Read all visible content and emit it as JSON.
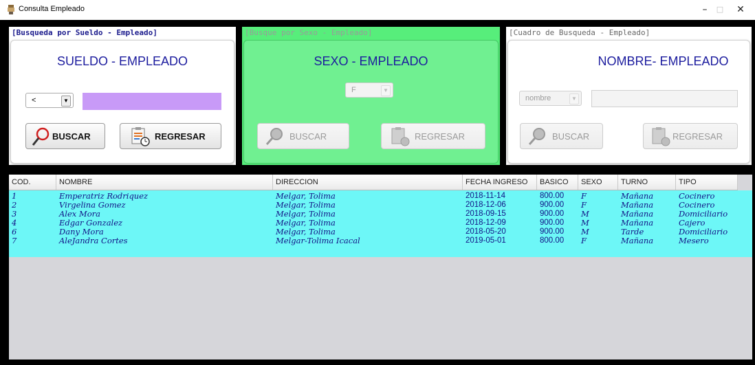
{
  "window": {
    "title": "Consulta Empleado",
    "minimize": "–",
    "maximize": "□",
    "close": "✕"
  },
  "panels": {
    "sueldo": {
      "title": "[Busqueda por Sueldo - Empleado]",
      "heading": "SUELDO - EMPLEADO",
      "combo_value": "<",
      "input_value": "",
      "input_color": "#c89af7",
      "buscar_label": "BUSCAR",
      "regresar_label": "REGRESAR"
    },
    "sexo": {
      "title": "[Busque por Sexo - Empleado]",
      "heading": "SEXO - EMPLEADO",
      "combo_value": "F",
      "buscar_label": "BUSCAR",
      "regresar_label": "REGRESAR"
    },
    "nombre": {
      "title": "[Cuadro de Busqueda - Empleado]",
      "heading": "NOMBRE- EMPLEADO",
      "combo_value": "nombre",
      "input_value": "",
      "buscar_label": "BUSCAR",
      "regresar_label": "REGRESAR"
    }
  },
  "table": {
    "columns": [
      "COD.",
      "NOMBRE",
      "DIRECCION",
      "FECHA INGRESO",
      "BASICO",
      "SEXO",
      "TURNO",
      "TIPO"
    ],
    "rows": [
      [
        "1",
        "Emperatriz Rodriquez",
        "Melgar, Tolima",
        "2018-11-14",
        "800.00",
        "F",
        "Mañana",
        "Cocinero"
      ],
      [
        "2",
        "Virgelina Gomez",
        "Melgar, Tolima",
        "2018-12-06",
        "900.00",
        "F",
        "Mañana",
        "Cocinero"
      ],
      [
        "3",
        "Alex Mora",
        "Melgar, Tolima",
        "2018-09-15",
        "900.00",
        "M",
        "Mañana",
        "Domiciliario"
      ],
      [
        "4",
        "Edgar Gonzalez",
        "Melgar, Tolima",
        "2018-12-09",
        "900.00",
        "M",
        "Mañana",
        "Cajero"
      ],
      [
        "6",
        "Dany Mora",
        "Melgar, Tolima",
        "2018-05-20",
        "900.00",
        "M",
        "Tarde",
        "Domiciliario"
      ],
      [
        "7",
        "AleJandra Cortes",
        "Melgar-Tolima Icacal",
        "2019-05-01",
        "800.00",
        "F",
        "Mañana",
        "Mesero"
      ]
    ],
    "row_color": "#6df7f7",
    "empty_color": "#d6d6da"
  }
}
